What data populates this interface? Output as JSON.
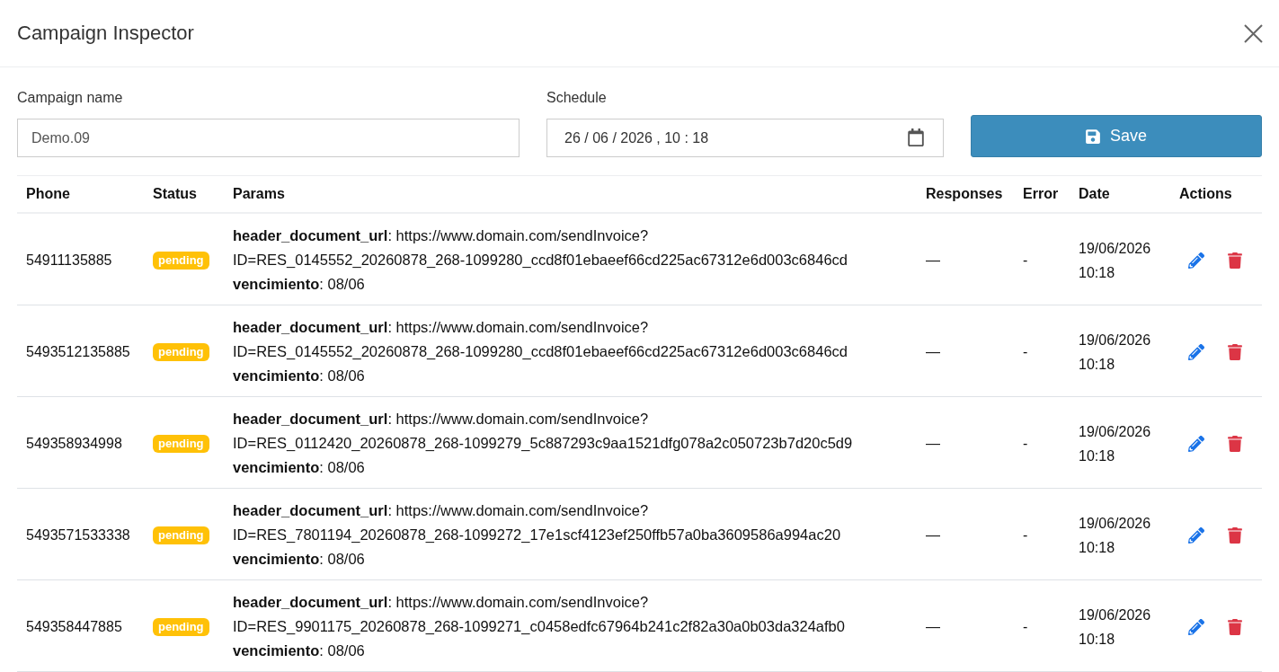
{
  "window": {
    "title": "Campaign Inspector"
  },
  "form": {
    "campaign_name": {
      "label": "Campaign name",
      "value": "Demo.09"
    },
    "schedule": {
      "label": "Schedule",
      "value": "26 / 06 / 2026 , 10 : 18"
    },
    "save_button": "Save"
  },
  "table": {
    "columns": [
      "Phone",
      "Status",
      "Params",
      "Responses",
      "Error",
      "Date",
      "Actions"
    ],
    "rows": [
      {
        "phone": "54911135885",
        "status": {
          "label": "pending",
          "color": "#ffc107"
        },
        "params": [
          "**header_document_url**: https://www.domain.com/sendInvoice?",
          "ID=RES_0145552_20260878_268-1099280_ccd8f01ebaeef66cd225ac67312e6d003c6846cd",
          "**vencimiento**: 08/06"
        ],
        "responses": "—",
        "error": "-",
        "date": "19/06/2026",
        "time": "10:18"
      },
      {
        "phone": "5493512135885",
        "status": {
          "label": "pending",
          "color": "#ffc107"
        },
        "params": [
          "**header_document_url**: https://www.domain.com/sendInvoice?",
          "ID=RES_0145552_20260878_268-1099280_ccd8f01ebaeef66cd225ac67312e6d003c6846cd",
          "**vencimiento**: 08/06"
        ],
        "responses": "—",
        "error": "-",
        "date": "19/06/2026",
        "time": "10:18"
      },
      {
        "phone": "549358934998",
        "status": {
          "label": "pending",
          "color": "#ffc107"
        },
        "params": [
          "**header_document_url**: https://www.domain.com/sendInvoice?",
          "ID=RES_0112420_20260878_268-1099279_5c887293c9aa1521dfg078a2c050723b7d20c5d9",
          "**vencimiento**: 08/06"
        ],
        "responses": "—",
        "error": "-",
        "date": "19/06/2026",
        "time": "10:18"
      },
      {
        "phone": "5493571533338",
        "status": {
          "label": "pending",
          "color": "#ffc107"
        },
        "params": [
          "**header_document_url**: https://www.domain.com/sendInvoice?",
          "ID=RES_7801194_20260878_268-1099272_17e1scf4123ef250ffb57a0ba3609586a994ac20",
          "**vencimiento**: 08/06"
        ],
        "responses": "—",
        "error": "-",
        "date": "19/06/2026",
        "time": "10:18"
      },
      {
        "phone": "549358447885",
        "status": {
          "label": "pending",
          "color": "#ffc107"
        },
        "params": [
          "**header_document_url**: https://www.domain.com/sendInvoice?",
          "ID=RES_9901175_20260878_268-1099271_c0458edfc67964b241c2f82a30a0b03da324afb0",
          "**vencimiento**: 08/06"
        ],
        "responses": "—",
        "error": "-",
        "date": "19/06/2026",
        "time": "10:18"
      }
    ]
  }
}
